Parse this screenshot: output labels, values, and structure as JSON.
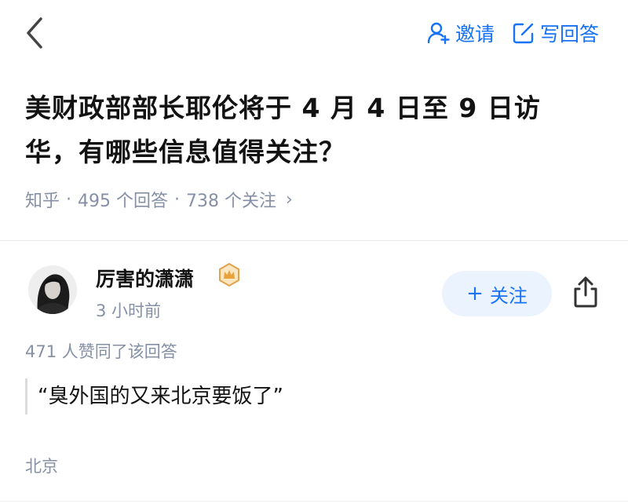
{
  "header": {
    "back_icon": "chevron-left-icon",
    "invite_icon": "person-add-icon",
    "invite_label": "邀请",
    "write_icon": "edit-square-icon",
    "write_label": "写回答",
    "accent_color": "#1772f6"
  },
  "question": {
    "title": "美财政部部长耶伦将于 4 月 4 日至 9 日访华，有哪些信息值得关注？",
    "source": "知乎",
    "separator": "·",
    "answers_count": "495 个回答",
    "followers_count": "738 个关注",
    "chevron": "›"
  },
  "answer": {
    "author_name": "厉害的潇潇",
    "badge_icon": "crown-badge-icon",
    "post_time": "3 小时前",
    "follow_plus": "+",
    "follow_label": "关注",
    "share_icon": "share-icon",
    "upvote_text": "471 人赞同了该回答",
    "quote": "“臭外国的又来北京要饭了”",
    "location": "北京"
  }
}
